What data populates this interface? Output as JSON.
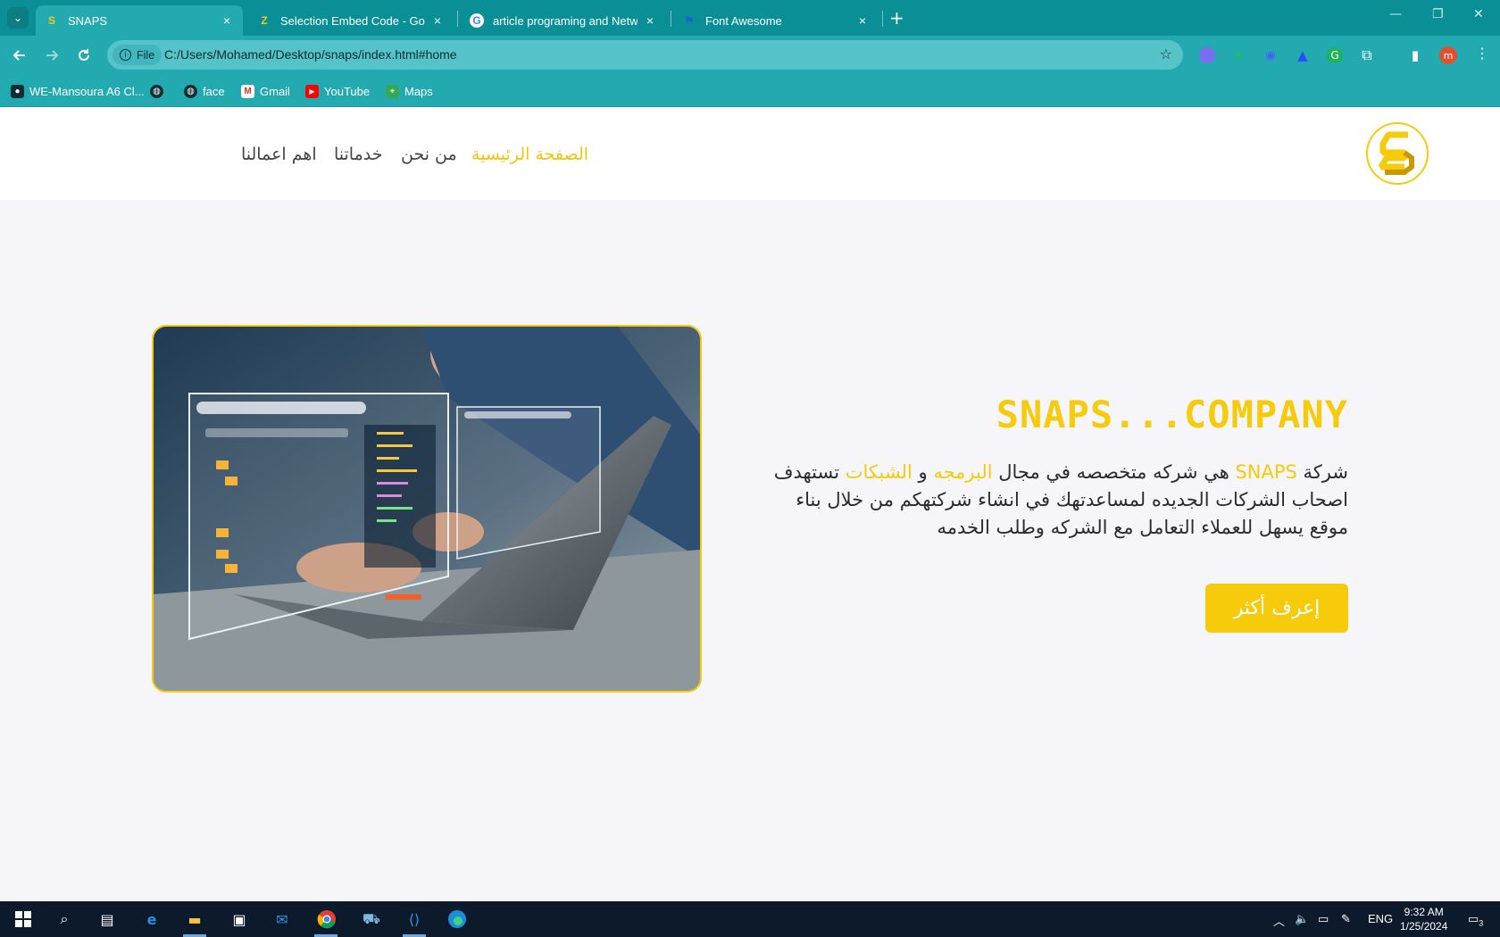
{
  "browser": {
    "tabs": [
      {
        "title": "SNAPS",
        "icon": "snaps-favicon"
      },
      {
        "title": "Selection Embed Code - Google",
        "icon": "embed-favicon"
      },
      {
        "title": "article programing and Network",
        "icon": "google-favicon"
      },
      {
        "title": "Font Awesome",
        "icon": "flag-favicon"
      }
    ],
    "close_glyph": "×",
    "new_tab": "+",
    "window_controls": {
      "minimize": "—",
      "restore": "❐",
      "close": "✕"
    },
    "address": {
      "scheme_label": "File",
      "url": "C:/Users/Mohamed/Desktop/snaps/index.html#home"
    },
    "profile_initial": "m",
    "bookmarks": [
      {
        "label": "WE-Mansoura A6 Cl...",
        "icon": "folder-person-icon"
      },
      {
        "label": "",
        "icon": "globe-icon"
      },
      {
        "label": "face",
        "icon": "globe-icon"
      },
      {
        "label": "Gmail",
        "icon": "gmail-icon"
      },
      {
        "label": "YouTube",
        "icon": "youtube-icon"
      },
      {
        "label": "Maps",
        "icon": "maps-icon"
      }
    ]
  },
  "site": {
    "nav": [
      {
        "label": "الصفحة الرئيسية",
        "active": true
      },
      {
        "label": "من نحن",
        "active": false
      },
      {
        "label": "خدماتنا",
        "active": false
      },
      {
        "label": "اهم اعمالنا",
        "active": false
      }
    ],
    "hero": {
      "title": "SNAPS...COMPANY",
      "text_parts": [
        "شركة ",
        "SNAPS",
        " هي شركه متخصصه في مجال ",
        "البرمجه",
        " و ",
        "الشبكات",
        " تستهدف اصحاب الشركات الجديده لمساعدتهك في انشاء شركتهكم من خلال بناء موقع يسهل للعملاء التعامل مع الشركه وطلب الخدمه"
      ],
      "cta": "إعرف أكثر"
    },
    "colors": {
      "accent": "#f5cb0c",
      "chrome": "#23aab1",
      "text": "#2b2b2b"
    }
  },
  "taskbar": {
    "language": "ENG",
    "time": "9:32 AM",
    "date": "1/25/2024",
    "notifications": "3"
  }
}
